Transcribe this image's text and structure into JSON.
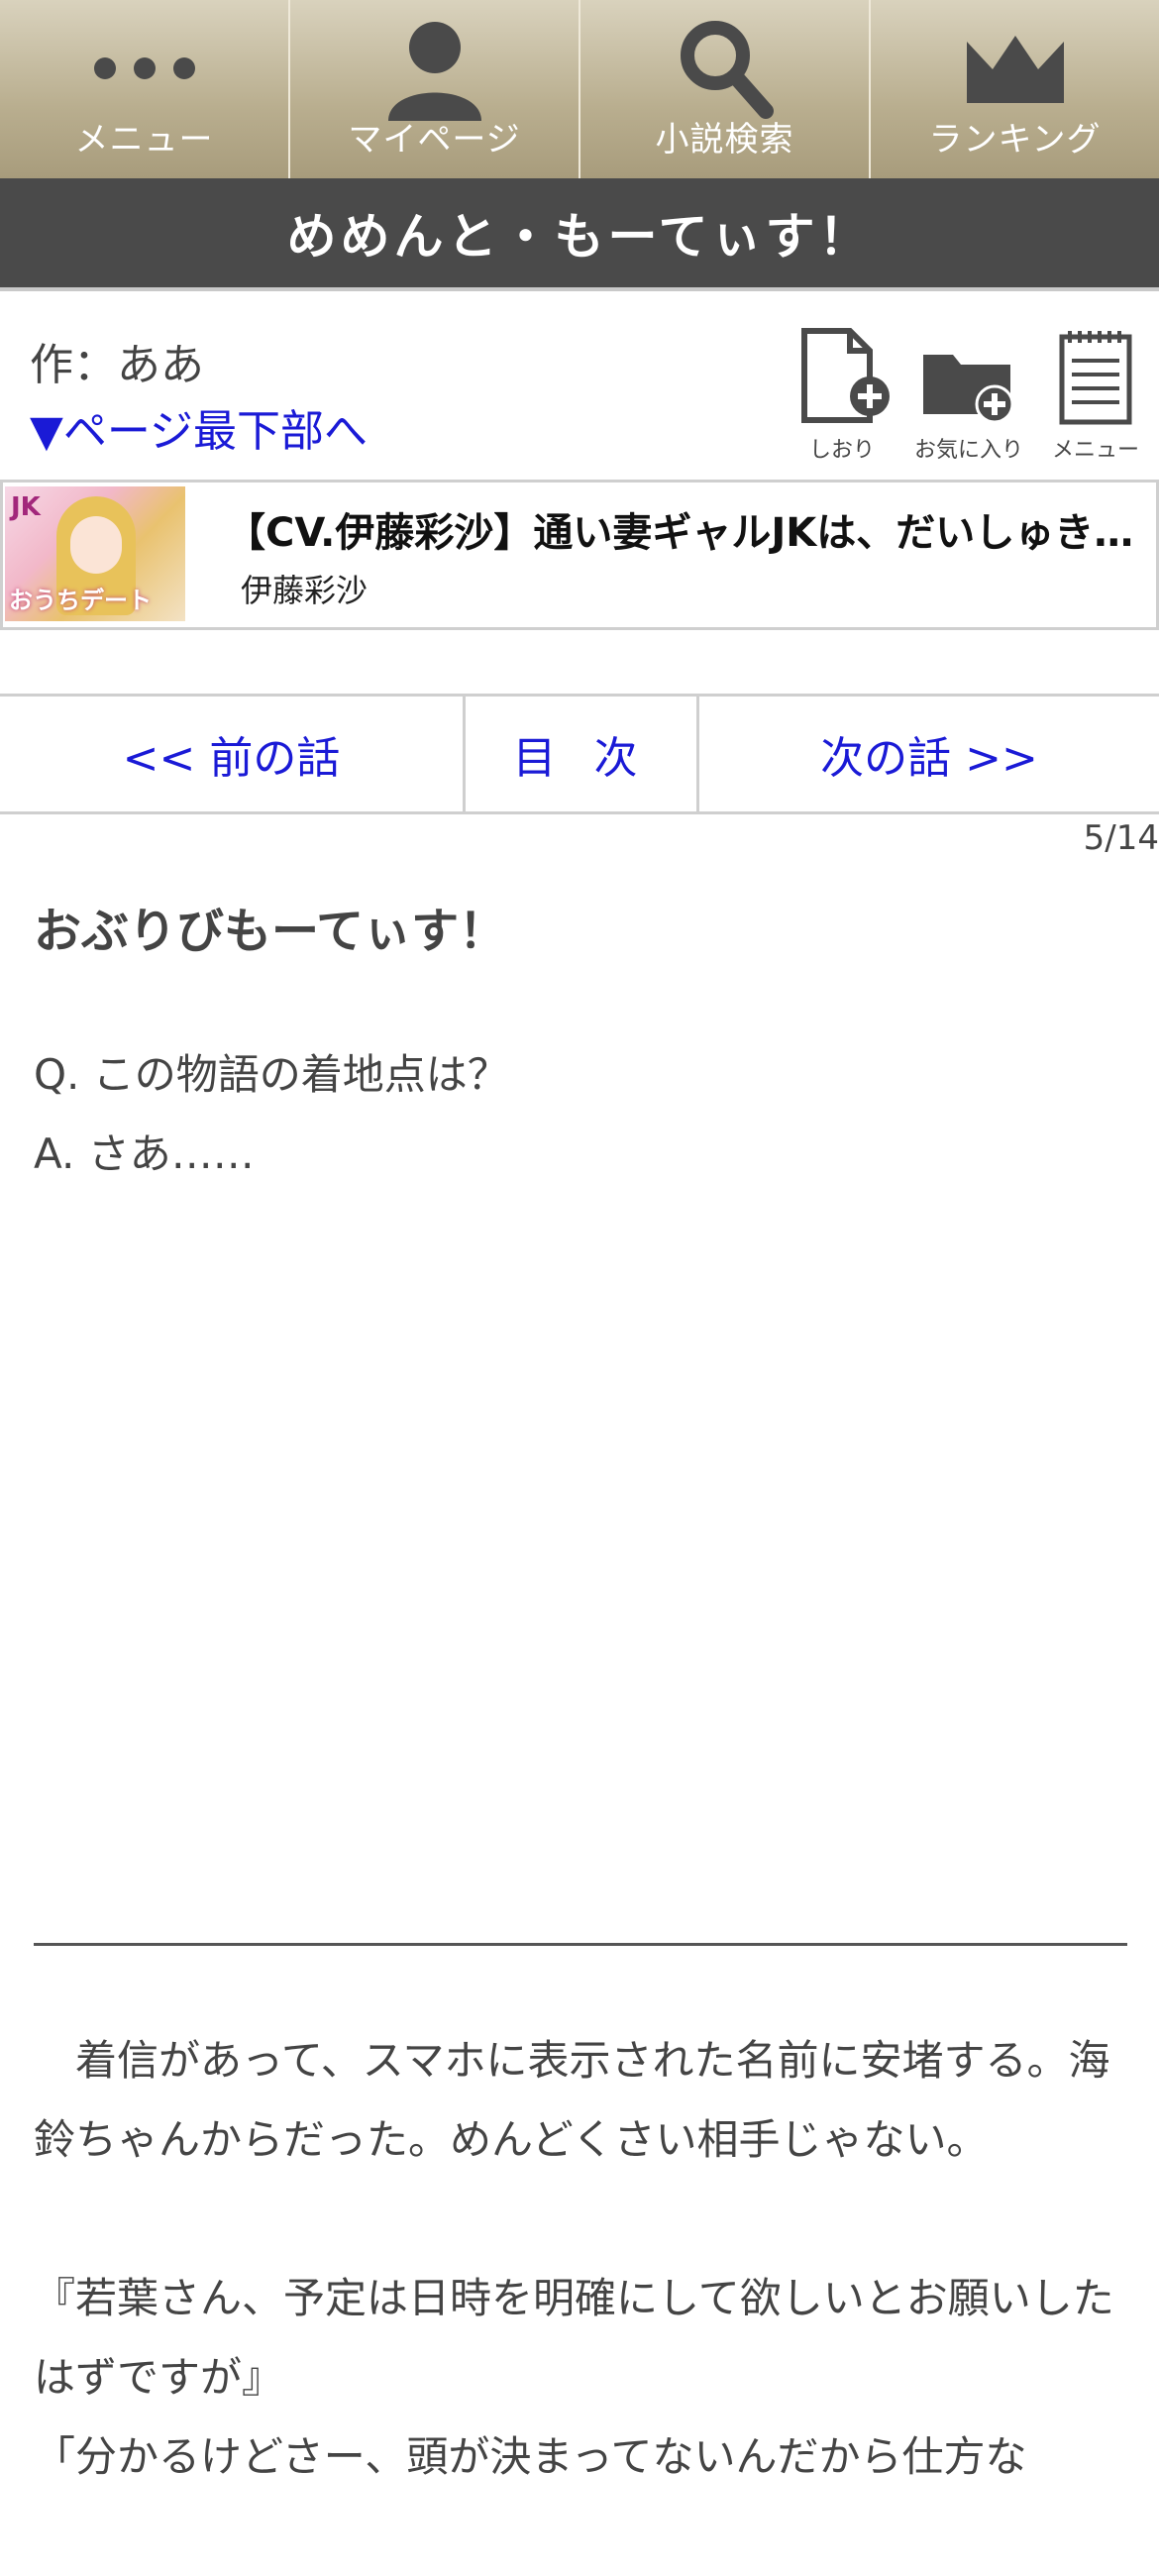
{
  "nav": {
    "items": [
      {
        "label": "メニュー",
        "icon": "dots-menu-icon"
      },
      {
        "label": "マイページ",
        "icon": "person-icon"
      },
      {
        "label": "小説検索",
        "icon": "search-icon"
      },
      {
        "label": "ランキング",
        "icon": "crown-icon"
      }
    ]
  },
  "title": "めめんと・もーてぃす！",
  "meta": {
    "author": "作：ああ",
    "to_bottom": "▼ページ最下部へ",
    "tools": [
      {
        "label": "しおり",
        "icon": "bookmark-add-icon"
      },
      {
        "label": "お気に入り",
        "icon": "folder-add-icon"
      },
      {
        "label": "メニュー",
        "icon": "notepad-menu-icon"
      }
    ]
  },
  "banner": {
    "title": "【CV.伊藤彩沙】通い妻ギャルJKは、だいしゅき…",
    "author": "伊藤彩沙",
    "thumb_text_top": "JK",
    "thumb_text_bottom": "おうちデート"
  },
  "episode_nav": {
    "prev": "<< 前の話",
    "toc": "目 次",
    "next": "次の話 >>"
  },
  "page_count": "5/14",
  "chapter_title": "おぶりびもーてぃす！",
  "preface": [
    "Q. この物語の着地点は？",
    "A. さあ……"
  ],
  "body": [
    "　着信があって、スマホに表示された名前に安堵する。海鈴ちゃんからだった。めんどくさい相手じゃない。",
    "『若葉さん、予定は日時を明確にして欲しいとお願いしたはずですが』",
    "「分かるけどさー、頭が決まってないんだから仕方な"
  ],
  "colors": {
    "nav_gradient_top": "#d9d2bd",
    "nav_gradient_bottom": "#a89c7c",
    "title_bar": "#4a4a4a",
    "link": "#1a1ad6",
    "text": "#444444"
  }
}
